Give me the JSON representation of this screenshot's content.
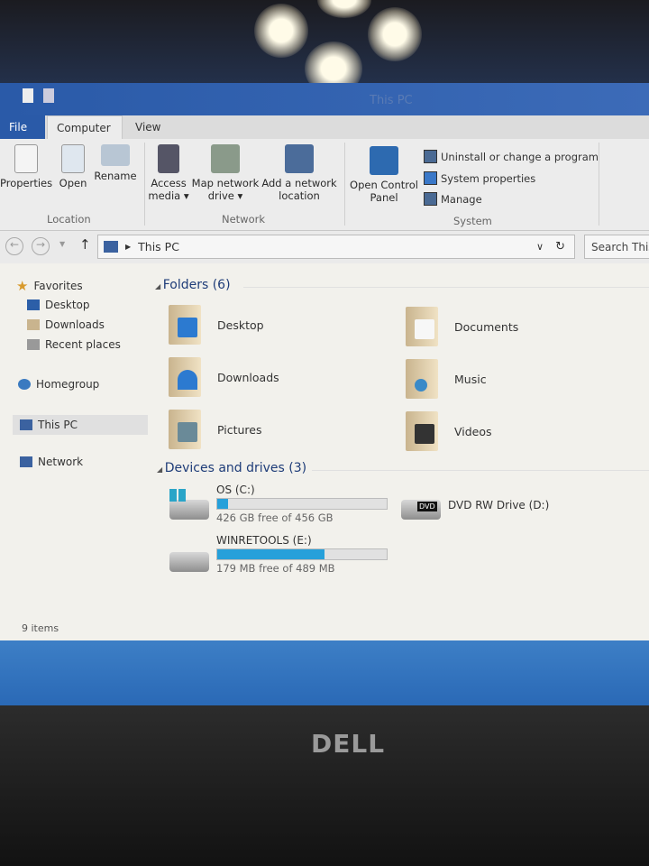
{
  "window": {
    "title": "This PC"
  },
  "tabs": [
    {
      "label": "File"
    },
    {
      "label": "Computer"
    },
    {
      "label": "View"
    }
  ],
  "ribbon": {
    "location": {
      "label": "Location",
      "buttons": [
        "Properties",
        "Open",
        "Rename"
      ]
    },
    "network": {
      "label": "Network",
      "buttons": [
        "Access media ▾",
        "Map network drive ▾",
        "Add a network location"
      ]
    },
    "system": {
      "label": "System",
      "open_control_panel": "Open Control Panel",
      "items": [
        "Uninstall or change a program",
        "System properties",
        "Manage"
      ]
    }
  },
  "address": {
    "path": "This PC",
    "search_placeholder": "Search This PC"
  },
  "sidebar": {
    "favorites": "Favorites",
    "fav_items": [
      "Desktop",
      "Downloads",
      "Recent places"
    ],
    "homegroup": "Homegroup",
    "this_pc": "This PC",
    "network": "Network"
  },
  "folders": {
    "header": "Folders (6)",
    "items": [
      "Desktop",
      "Documents",
      "Downloads",
      "Music",
      "Pictures",
      "Videos"
    ]
  },
  "drives": {
    "header": "Devices and drives (3)",
    "items": [
      {
        "name": "OS (C:)",
        "free": "426 GB free of 456 GB",
        "used_fraction": 0.066
      },
      {
        "name": "DVD RW Drive (D:)"
      },
      {
        "name": "WINRETOOLS (E:)",
        "free": "179 MB free of 489 MB",
        "used_fraction": 0.634
      }
    ]
  },
  "status": {
    "items": "9 items"
  },
  "bezel": {
    "brand": "DELL"
  },
  "colors": {
    "accent": "#26a0da",
    "titlebar": "#2a5aa8"
  }
}
